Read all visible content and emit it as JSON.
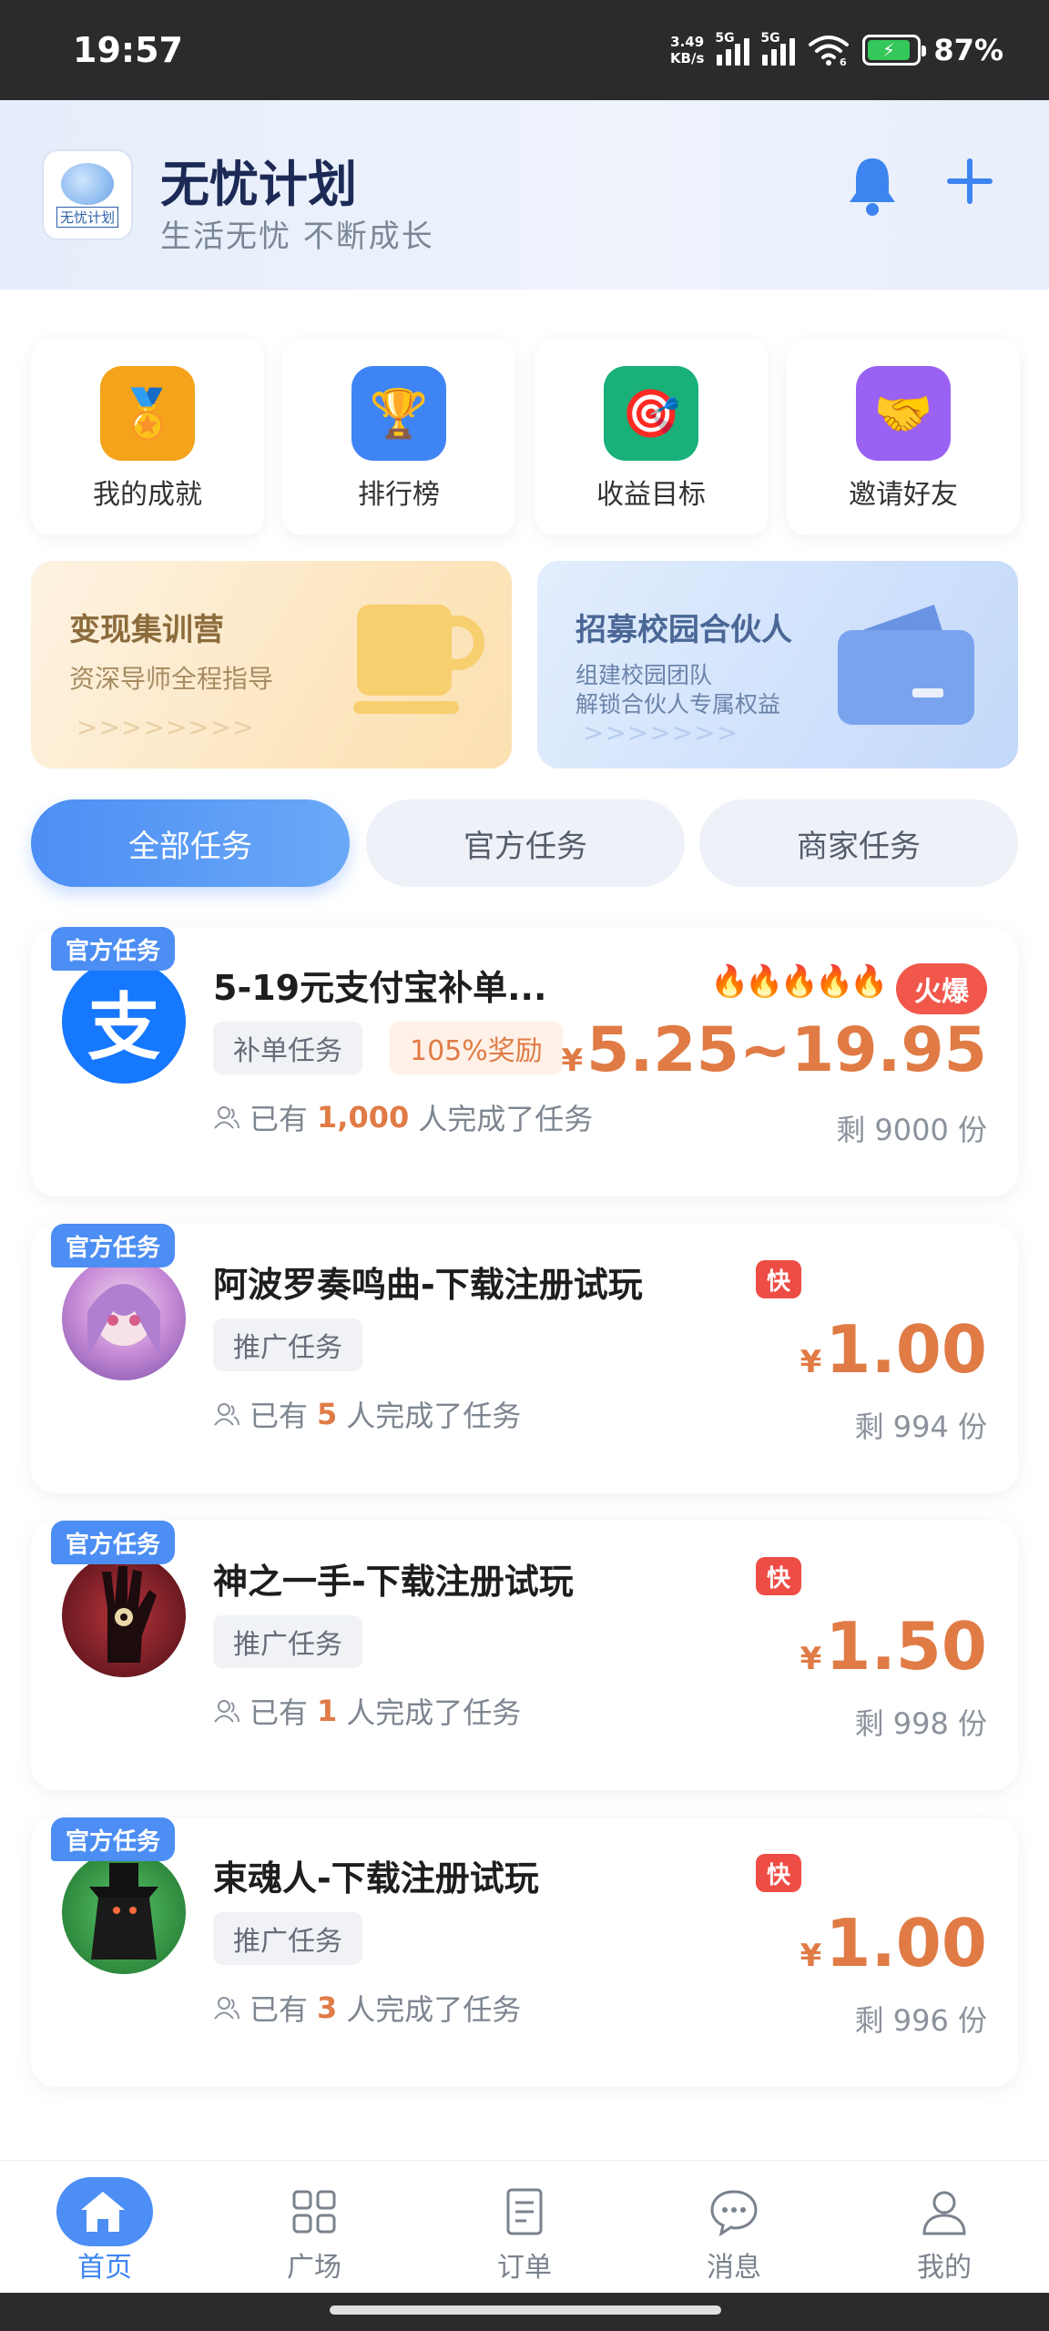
{
  "status_bar": {
    "time": "19:57",
    "net_speed": "3.49",
    "net_unit": "KB/s",
    "sig1_label": "5G",
    "sig2_label": "5G",
    "wifi_label": "6",
    "battery": "87%"
  },
  "header": {
    "logo_text": "无忧计划",
    "title": "无忧计划",
    "subtitle": "生活无忧 不断成长"
  },
  "quick_actions": [
    {
      "label": "我的成就",
      "icon": "medal-icon",
      "color": "#f5a31a"
    },
    {
      "label": "排行榜",
      "icon": "trophy-icon",
      "color": "#3f84f4"
    },
    {
      "label": "收益目标",
      "icon": "target-icon",
      "color": "#19b07a"
    },
    {
      "label": "邀请好友",
      "icon": "handshake-icon",
      "color": "#9a62f2"
    }
  ],
  "banners": [
    {
      "title": "变现集训营",
      "sub": "资深导师全程指导",
      "arrows": ">>>>>>>>"
    },
    {
      "title": "招募校园合伙人",
      "sub": "组建校园团队",
      "sub2": "解锁合伙人专属权益",
      "arrows": ">>>>>>>"
    }
  ],
  "tabs": [
    {
      "label": "全部任务",
      "active": true
    },
    {
      "label": "官方任务",
      "active": false
    },
    {
      "label": "商家任务",
      "active": false
    }
  ],
  "tasks": [
    {
      "badge": "官方任务",
      "title": "5-19元支付宝补单...",
      "chips": [
        "补单任务",
        "105%奖励"
      ],
      "done_prefix": "已有",
      "done_count": "1,000",
      "done_suffix": "人完成了任务",
      "yen": "¥",
      "price": "5.25~19.95",
      "remain": "剩 9000 份",
      "hot": "火爆",
      "flames": "🔥🔥🔥🔥🔥"
    },
    {
      "badge": "官方任务",
      "title": "阿波罗奏鸣曲-下载注册试玩",
      "chips": [
        "推广任务"
      ],
      "done_prefix": "已有",
      "done_count": "5",
      "done_suffix": "人完成了任务",
      "yen": "¥",
      "price": "1.00",
      "remain": "剩 994 份",
      "fast": "快"
    },
    {
      "badge": "官方任务",
      "title": "神之一手-下载注册试玩",
      "chips": [
        "推广任务"
      ],
      "done_prefix": "已有",
      "done_count": "1",
      "done_suffix": "人完成了任务",
      "yen": "¥",
      "price": "1.50",
      "remain": "剩 998 份",
      "fast": "快"
    },
    {
      "badge": "官方任务",
      "title": "束魂人-下载注册试玩",
      "chips": [
        "推广任务"
      ],
      "done_prefix": "已有",
      "done_count": "3",
      "done_suffix": "人完成了任务",
      "yen": "¥",
      "price": "1.00",
      "remain": "剩 996 份",
      "fast": "快"
    }
  ],
  "bottom_nav": [
    {
      "label": "首页",
      "icon": "home-icon",
      "active": true
    },
    {
      "label": "广场",
      "icon": "grid-icon",
      "active": false
    },
    {
      "label": "订单",
      "icon": "document-icon",
      "active": false
    },
    {
      "label": "消息",
      "icon": "chat-icon",
      "active": false
    },
    {
      "label": "我的",
      "icon": "user-icon",
      "active": false
    }
  ],
  "colors": {
    "accent": "#4c8ef4",
    "price": "#e07b45",
    "hot": "#f2574c"
  }
}
